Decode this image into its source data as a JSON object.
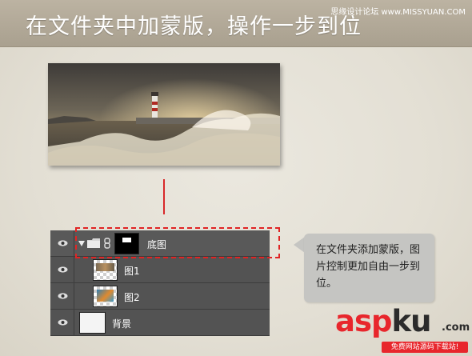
{
  "header": {
    "title": "在文件夹中加蒙版，操作一步到位",
    "credit": "思缘设计论坛 www.MISSYUAN.COM"
  },
  "layers_panel": {
    "layers": [
      {
        "name": "底图",
        "type": "group",
        "visible": true,
        "expanded": true,
        "has_mask": true,
        "linked": true
      },
      {
        "name": "图1",
        "type": "layer",
        "visible": true,
        "indent": true
      },
      {
        "name": "图2",
        "type": "layer",
        "visible": true,
        "indent": true
      },
      {
        "name": "背景",
        "type": "layer",
        "visible": true
      }
    ]
  },
  "callout": {
    "text": "在文件夹添加蒙版，图片控制更加自由一步到位。"
  },
  "watermark": {
    "word_red": "asp",
    "word_dark": "ku",
    "suffix": ".com",
    "tagline": "免费网站源码下载站!"
  },
  "icons": {
    "visibility": "eye-icon",
    "expand": "triangle-down-icon",
    "group": "folder-icon",
    "link": "chain-link-icon"
  },
  "colors": {
    "accent_red": "#e02424",
    "panel_bg": "#535353",
    "header_bg": "#b3aa98",
    "brand_red": "#e8262c"
  }
}
